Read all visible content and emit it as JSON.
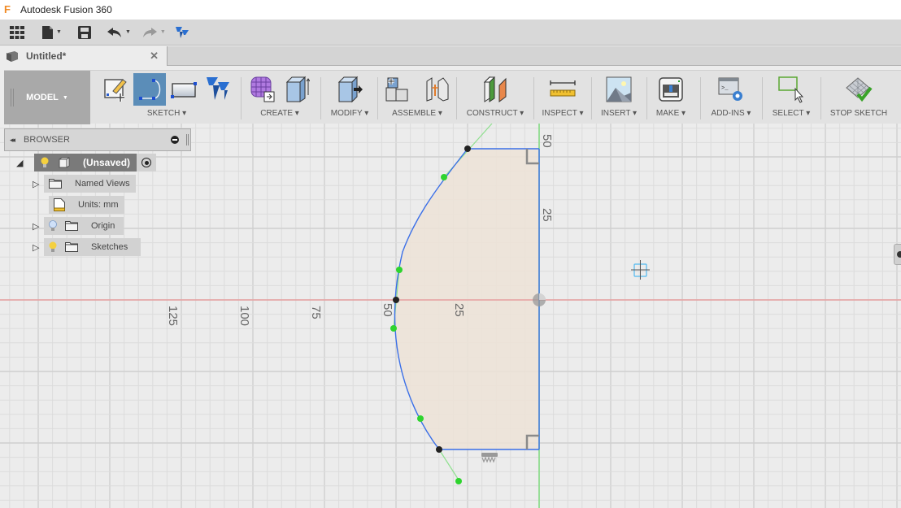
{
  "app": {
    "title": "Autodesk Fusion 360",
    "logo_glyph": "F"
  },
  "quick_access": {
    "items": [
      {
        "name": "data-panel",
        "icon": "grid-icon"
      },
      {
        "name": "file",
        "icon": "file-icon",
        "has_dropdown": true
      },
      {
        "name": "save",
        "icon": "save-icon"
      },
      {
        "name": "undo",
        "icon": "undo-icon",
        "has_dropdown": true
      },
      {
        "name": "redo",
        "icon": "redo-icon",
        "has_dropdown": true
      },
      {
        "name": "fusion-logo",
        "icon": "fusion-logo-icon"
      }
    ]
  },
  "document_tab": {
    "label": "Untitled*",
    "close_glyph": "✕"
  },
  "ribbon": {
    "workspace": "MODEL",
    "groups": [
      {
        "label": "SKETCH ▾",
        "icons": [
          "create-sketch-icon",
          "arc-icon",
          "rectangle-icon",
          "fusion-sketch-icon"
        ]
      },
      {
        "label": "CREATE ▾",
        "icons": [
          "form-icon",
          "extrude-icon"
        ]
      },
      {
        "label": "MODIFY ▾",
        "icons": [
          "press-pull-icon"
        ]
      },
      {
        "label": "ASSEMBLE ▾",
        "icons": [
          "new-component-icon",
          "joint-icon"
        ]
      },
      {
        "label": "CONSTRUCT ▾",
        "icons": [
          "offset-plane-icon"
        ]
      },
      {
        "label": "INSPECT ▾",
        "icons": [
          "measure-icon"
        ]
      },
      {
        "label": "INSERT ▾",
        "icons": [
          "insert-image-icon"
        ]
      },
      {
        "label": "MAKE ▾",
        "icons": [
          "3d-print-icon"
        ]
      },
      {
        "label": "ADD-INS ▾",
        "icons": [
          "scripts-icon"
        ]
      },
      {
        "label": "SELECT ▾",
        "icons": [
          "select-icon"
        ]
      },
      {
        "label": "STOP SKETCH",
        "icons": [
          "stop-sketch-icon"
        ]
      }
    ]
  },
  "browser": {
    "title": "BROWSER",
    "collapse_glyph": "◂◂",
    "root": {
      "label": "(Unsaved)"
    },
    "items": [
      {
        "label": "Named Views",
        "expandable": true,
        "bulb": false
      },
      {
        "label": "Units: mm",
        "expandable": false,
        "bulb": false
      },
      {
        "label": "Origin",
        "expandable": true,
        "bulb": "off"
      },
      {
        "label": "Sketches",
        "expandable": true,
        "bulb": "on"
      }
    ]
  },
  "viewport": {
    "axis_labels_horizontal": [
      "125",
      "100",
      "75",
      "50",
      "25"
    ],
    "axis_labels_vertical": [
      "50",
      "25"
    ],
    "colors": {
      "x_axis": "#e8a0a0",
      "y_axis": "#7fdc7f",
      "sketch_line": "#3a6fe8",
      "profile_fill": "#ede3d7",
      "point_green": "#2ed42e",
      "point_black": "#222222",
      "grid_minor": "#dcdcdc",
      "grid_major": "#cfcfcf"
    }
  }
}
